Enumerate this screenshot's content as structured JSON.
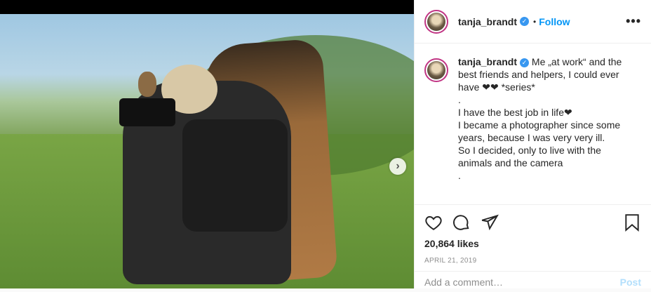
{
  "post": {
    "username": "tanja_brandt",
    "follow_label": "Follow",
    "separator": "•",
    "more_label": "•••",
    "caption_lines": [
      "Me „at work“ and the best friends and helpers, I could ever have ❤❤ *series*",
      ".",
      "",
      "I have the best job in life❤",
      "I became a photographer since some years, because I was very very ill.",
      "So I decided, only to live with the animals and the camera ",
      "."
    ],
    "likes": "20,864 likes",
    "date": "APRIL 21, 2019",
    "comment_placeholder": "Add a comment…",
    "post_label": "Post",
    "next_arrow": "›"
  },
  "colors": {
    "accent": "#0095f6",
    "verified": "#3897f0",
    "avatar_ring": "#c13584"
  },
  "icons": [
    "heart-icon",
    "comment-icon",
    "share-icon",
    "bookmark-icon",
    "verified-badge-icon",
    "more-options-icon",
    "next-arrow-icon"
  ]
}
